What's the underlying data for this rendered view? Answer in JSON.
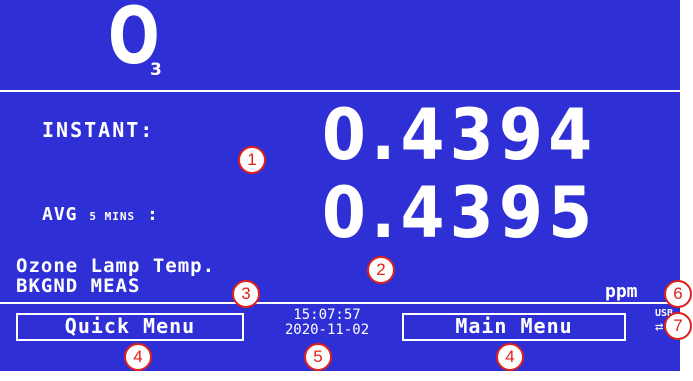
{
  "gas": {
    "symbol": "O",
    "subscript": "3"
  },
  "readings": {
    "instant_label": "INSTANT:",
    "instant_value": "0.4394",
    "avg_label_main": "AVG",
    "avg_label_window": "5 MINS",
    "avg_label_colon": ":",
    "avg_value": "0.4395",
    "unit": "ppm"
  },
  "status": {
    "line1": "Ozone Lamp Temp.",
    "line2": "BKGND MEAS"
  },
  "buttons": {
    "quick_menu": "Quick Menu",
    "main_menu": "Main Menu"
  },
  "clock": {
    "time": "15:07:57",
    "date": "2020-11-02"
  },
  "usb": {
    "label": "USB",
    "arrow": "⇄"
  },
  "callouts": {
    "c1": "1",
    "c2": "2",
    "c3": "3",
    "c4a": "4",
    "c4b": "4",
    "c5": "5",
    "c6": "6",
    "c7": "7"
  },
  "colors": {
    "screen": "#2f2fd6",
    "text": "#ffffff",
    "callout": "#e0201b"
  }
}
